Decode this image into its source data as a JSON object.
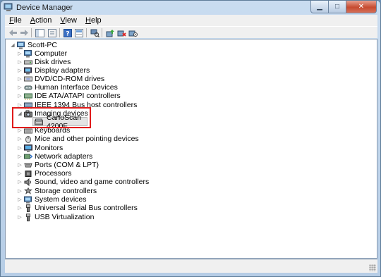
{
  "window": {
    "title": "Device Manager"
  },
  "menu": [
    {
      "pre": "",
      "u": "F",
      "post": "ile"
    },
    {
      "pre": "",
      "u": "A",
      "post": "ction"
    },
    {
      "pre": "",
      "u": "V",
      "post": "iew"
    },
    {
      "pre": "",
      "u": "H",
      "post": "elp"
    }
  ],
  "toolbar": {
    "buttons": [
      "back",
      "forward",
      "show-hide-console-tree",
      "properties",
      "help",
      "properties-sheet",
      "scan-hardware",
      "update-driver",
      "uninstall",
      "disable"
    ]
  },
  "tree": {
    "root": "Scott-PC",
    "categories": [
      {
        "label": "Computer",
        "icon": "computer-icon"
      },
      {
        "label": "Disk drives",
        "icon": "disk-drive-icon"
      },
      {
        "label": "Display adapters",
        "icon": "display-adapter-icon"
      },
      {
        "label": "DVD/CD-ROM drives",
        "icon": "dvd-drive-icon"
      },
      {
        "label": "Human Interface Devices",
        "icon": "hid-icon"
      },
      {
        "label": "IDE ATA/ATAPI controllers",
        "icon": "ide-controller-icon"
      },
      {
        "label": "IEEE 1394 Bus host controllers",
        "icon": "firewire-icon"
      },
      {
        "label": "Imaging devices",
        "icon": "imaging-device-icon",
        "expanded": true,
        "children": [
          "CanoScan 4200F"
        ]
      },
      {
        "label": "Keyboards",
        "icon": "keyboard-icon"
      },
      {
        "label": "Mice and other pointing devices",
        "icon": "mouse-icon"
      },
      {
        "label": "Monitors",
        "icon": "monitor-icon"
      },
      {
        "label": "Network adapters",
        "icon": "network-adapter-icon"
      },
      {
        "label": "Ports (COM & LPT)",
        "icon": "port-icon"
      },
      {
        "label": "Processors",
        "icon": "processor-icon"
      },
      {
        "label": "Sound, video and game controllers",
        "icon": "sound-icon"
      },
      {
        "label": "Storage controllers",
        "icon": "storage-controller-icon"
      },
      {
        "label": "System devices",
        "icon": "system-devices-icon"
      },
      {
        "label": "Universal Serial Bus controllers",
        "icon": "usb-controller-icon"
      },
      {
        "label": "USB Virtualization",
        "icon": "usb-virtualization-icon"
      }
    ]
  },
  "colors": {
    "highlight": "#e01a1a",
    "selection": "#e4e4e4",
    "close": "#c64b30"
  }
}
